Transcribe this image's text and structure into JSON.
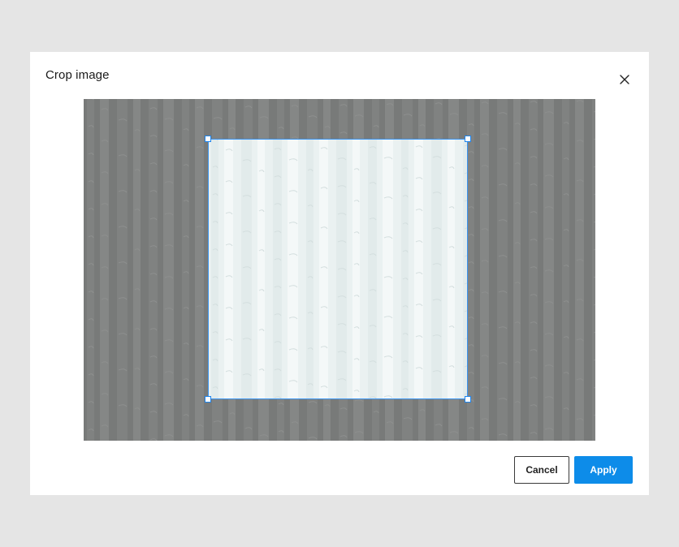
{
  "dialog": {
    "title": "Crop image",
    "close_icon": "close-icon",
    "cancel_label": "Cancel",
    "apply_label": "Apply"
  },
  "colors": {
    "accent": "#0d8ce9",
    "crop_border": "#3b95f2",
    "image_dim": "#7d7f7e",
    "image_light": "#eef4f4",
    "backdrop": "#e5e5e5"
  }
}
